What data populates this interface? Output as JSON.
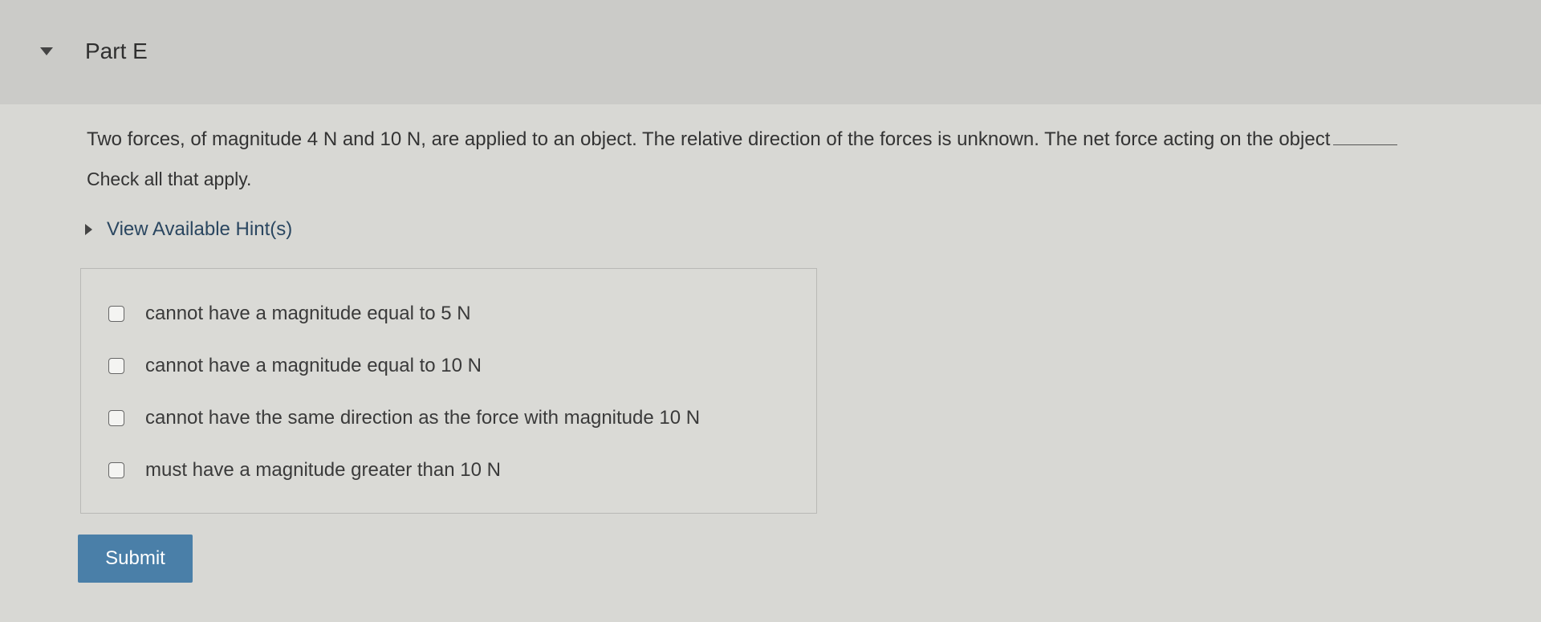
{
  "part": {
    "title": "Part E"
  },
  "question": {
    "text": "Two forces, of magnitude 4 N and 10 N, are applied to an object. The relative direction of the forces is unknown. The net force acting on the object"
  },
  "instruction": "Check all that apply.",
  "hints": {
    "label": "View Available Hint(s)"
  },
  "options": [
    {
      "label": "cannot have a magnitude equal to 5 N",
      "checked": false
    },
    {
      "label": "cannot have a magnitude equal to 10 N",
      "checked": false
    },
    {
      "label": "cannot have the same direction as the force with magnitude 10 N",
      "checked": false
    },
    {
      "label": "must have a magnitude greater than 10 N",
      "checked": false
    }
  ],
  "submit": {
    "label": "Submit"
  },
  "colors": {
    "submit_bg": "#4a7fa8",
    "link_text": "#2a4660",
    "page_bg": "#d8d8d4",
    "header_bg": "#cbcbc8"
  }
}
